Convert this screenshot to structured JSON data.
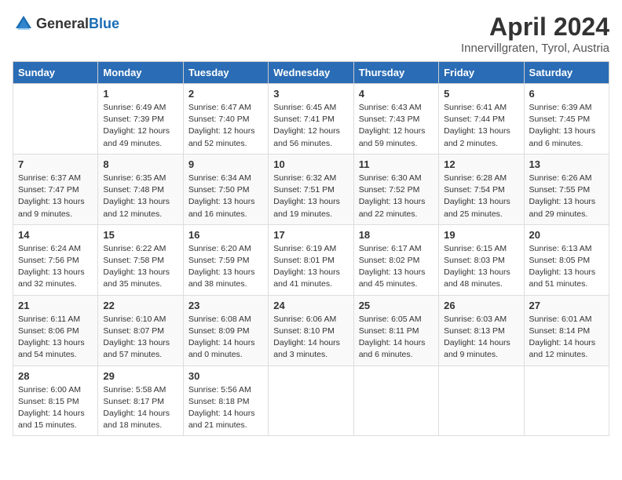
{
  "header": {
    "logo_general": "General",
    "logo_blue": "Blue",
    "title": "April 2024",
    "subtitle": "Innervillgraten, Tyrol, Austria"
  },
  "days_of_week": [
    "Sunday",
    "Monday",
    "Tuesday",
    "Wednesday",
    "Thursday",
    "Friday",
    "Saturday"
  ],
  "weeks": [
    [
      {
        "day": "",
        "content": ""
      },
      {
        "day": "1",
        "content": "Sunrise: 6:49 AM\nSunset: 7:39 PM\nDaylight: 12 hours\nand 49 minutes."
      },
      {
        "day": "2",
        "content": "Sunrise: 6:47 AM\nSunset: 7:40 PM\nDaylight: 12 hours\nand 52 minutes."
      },
      {
        "day": "3",
        "content": "Sunrise: 6:45 AM\nSunset: 7:41 PM\nDaylight: 12 hours\nand 56 minutes."
      },
      {
        "day": "4",
        "content": "Sunrise: 6:43 AM\nSunset: 7:43 PM\nDaylight: 12 hours\nand 59 minutes."
      },
      {
        "day": "5",
        "content": "Sunrise: 6:41 AM\nSunset: 7:44 PM\nDaylight: 13 hours\nand 2 minutes."
      },
      {
        "day": "6",
        "content": "Sunrise: 6:39 AM\nSunset: 7:45 PM\nDaylight: 13 hours\nand 6 minutes."
      }
    ],
    [
      {
        "day": "7",
        "content": "Sunrise: 6:37 AM\nSunset: 7:47 PM\nDaylight: 13 hours\nand 9 minutes."
      },
      {
        "day": "8",
        "content": "Sunrise: 6:35 AM\nSunset: 7:48 PM\nDaylight: 13 hours\nand 12 minutes."
      },
      {
        "day": "9",
        "content": "Sunrise: 6:34 AM\nSunset: 7:50 PM\nDaylight: 13 hours\nand 16 minutes."
      },
      {
        "day": "10",
        "content": "Sunrise: 6:32 AM\nSunset: 7:51 PM\nDaylight: 13 hours\nand 19 minutes."
      },
      {
        "day": "11",
        "content": "Sunrise: 6:30 AM\nSunset: 7:52 PM\nDaylight: 13 hours\nand 22 minutes."
      },
      {
        "day": "12",
        "content": "Sunrise: 6:28 AM\nSunset: 7:54 PM\nDaylight: 13 hours\nand 25 minutes."
      },
      {
        "day": "13",
        "content": "Sunrise: 6:26 AM\nSunset: 7:55 PM\nDaylight: 13 hours\nand 29 minutes."
      }
    ],
    [
      {
        "day": "14",
        "content": "Sunrise: 6:24 AM\nSunset: 7:56 PM\nDaylight: 13 hours\nand 32 minutes."
      },
      {
        "day": "15",
        "content": "Sunrise: 6:22 AM\nSunset: 7:58 PM\nDaylight: 13 hours\nand 35 minutes."
      },
      {
        "day": "16",
        "content": "Sunrise: 6:20 AM\nSunset: 7:59 PM\nDaylight: 13 hours\nand 38 minutes."
      },
      {
        "day": "17",
        "content": "Sunrise: 6:19 AM\nSunset: 8:01 PM\nDaylight: 13 hours\nand 41 minutes."
      },
      {
        "day": "18",
        "content": "Sunrise: 6:17 AM\nSunset: 8:02 PM\nDaylight: 13 hours\nand 45 minutes."
      },
      {
        "day": "19",
        "content": "Sunrise: 6:15 AM\nSunset: 8:03 PM\nDaylight: 13 hours\nand 48 minutes."
      },
      {
        "day": "20",
        "content": "Sunrise: 6:13 AM\nSunset: 8:05 PM\nDaylight: 13 hours\nand 51 minutes."
      }
    ],
    [
      {
        "day": "21",
        "content": "Sunrise: 6:11 AM\nSunset: 8:06 PM\nDaylight: 13 hours\nand 54 minutes."
      },
      {
        "day": "22",
        "content": "Sunrise: 6:10 AM\nSunset: 8:07 PM\nDaylight: 13 hours\nand 57 minutes."
      },
      {
        "day": "23",
        "content": "Sunrise: 6:08 AM\nSunset: 8:09 PM\nDaylight: 14 hours\nand 0 minutes."
      },
      {
        "day": "24",
        "content": "Sunrise: 6:06 AM\nSunset: 8:10 PM\nDaylight: 14 hours\nand 3 minutes."
      },
      {
        "day": "25",
        "content": "Sunrise: 6:05 AM\nSunset: 8:11 PM\nDaylight: 14 hours\nand 6 minutes."
      },
      {
        "day": "26",
        "content": "Sunrise: 6:03 AM\nSunset: 8:13 PM\nDaylight: 14 hours\nand 9 minutes."
      },
      {
        "day": "27",
        "content": "Sunrise: 6:01 AM\nSunset: 8:14 PM\nDaylight: 14 hours\nand 12 minutes."
      }
    ],
    [
      {
        "day": "28",
        "content": "Sunrise: 6:00 AM\nSunset: 8:15 PM\nDaylight: 14 hours\nand 15 minutes."
      },
      {
        "day": "29",
        "content": "Sunrise: 5:58 AM\nSunset: 8:17 PM\nDaylight: 14 hours\nand 18 minutes."
      },
      {
        "day": "30",
        "content": "Sunrise: 5:56 AM\nSunset: 8:18 PM\nDaylight: 14 hours\nand 21 minutes."
      },
      {
        "day": "",
        "content": ""
      },
      {
        "day": "",
        "content": ""
      },
      {
        "day": "",
        "content": ""
      },
      {
        "day": "",
        "content": ""
      }
    ]
  ]
}
